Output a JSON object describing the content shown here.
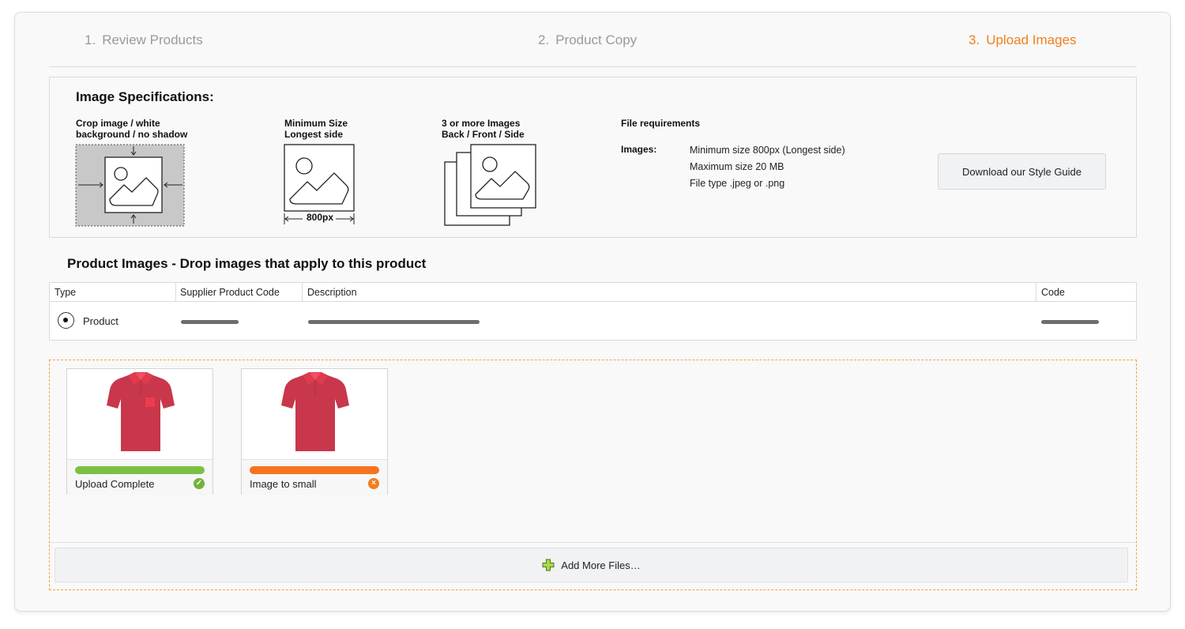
{
  "steps": [
    {
      "num": "1.",
      "label": "Review Products",
      "active": false
    },
    {
      "num": "2.",
      "label": "Product Copy",
      "active": false
    },
    {
      "num": "3.",
      "label": "Upload Images",
      "active": true
    }
  ],
  "specs": {
    "title": "Image Specifications:",
    "crop_label": "Crop image / white\nbackground / no shadow",
    "min_size_label": "Minimum Size\nLongest side",
    "min_size_value": "800px",
    "multi_label": "3 or more Images\nBack / Front / Side",
    "file_req_title": "File requirements",
    "file_req_key": "Images:",
    "file_req_lines": [
      "Minimum size 800px (Longest side)",
      "Maximum size 20 MB",
      "File type .jpeg or .png"
    ],
    "style_guide_button": "Download our Style Guide"
  },
  "product_images": {
    "title": "Product Images  -  Drop images that apply to this product",
    "columns": [
      "Type",
      "Supplier Product Code",
      "Description",
      "Code"
    ],
    "row": {
      "type": "Product",
      "selected": true
    }
  },
  "uploads": [
    {
      "status": "Upload Complete",
      "state": "success",
      "progress": 1.0,
      "bar_color": "#7bc043",
      "icon": "check-circle-icon",
      "icon_color": "#6fb43a"
    },
    {
      "status": "Image to small",
      "state": "error",
      "progress": 1.0,
      "bar_color": "#f7731f",
      "icon": "error-circle-icon",
      "icon_color": "#f07f1e"
    }
  ],
  "add_files_label": "Add More Files…",
  "colors": {
    "accent": "#f07f1e",
    "success": "#7bc043",
    "error": "#f7731f",
    "shirt": "#c8374b"
  }
}
